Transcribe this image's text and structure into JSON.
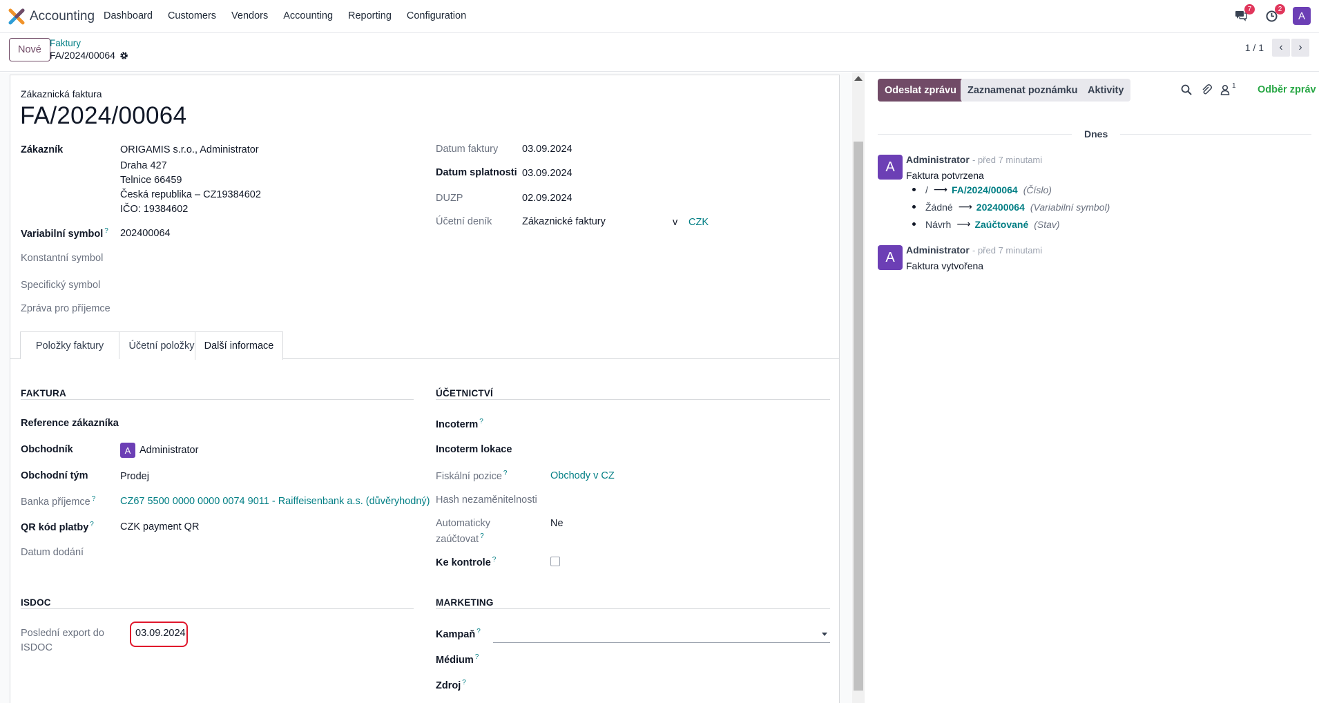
{
  "navbar": {
    "app_name": "Accounting",
    "menu": [
      "Dashboard",
      "Customers",
      "Vendors",
      "Accounting",
      "Reporting",
      "Configuration"
    ],
    "messages_count": "7",
    "activities_count": "2",
    "user_initial": "A"
  },
  "control_panel": {
    "new_label": "Nové",
    "breadcrumb_parent": "Faktury",
    "breadcrumb_current": "FA/2024/00064",
    "pager_value": "1 / 1"
  },
  "invoice": {
    "doc_type": "Zákaznická faktura",
    "number": "FA/2024/00064",
    "customer_label": "Zákazník",
    "customer_lines": [
      "ORIGAMIS s.r.o., Administrator",
      "Draha 427",
      "Telnice 66459",
      "Česká republika – CZ19384602",
      "IČO: 19384602"
    ],
    "variable_symbol_label": "Variabilní symbol",
    "variable_symbol": "202400064",
    "constant_symbol_label": "Konstantní symbol",
    "specific_symbol_label": "Specifický symbol",
    "message_label": "Zpráva pro příjemce",
    "invoice_date_label": "Datum faktury",
    "invoice_date": "03.09.2024",
    "due_date_label": "Datum splatnosti",
    "due_date": "03.09.2024",
    "duzp_label": "DUZP",
    "duzp": "02.09.2024",
    "journal_label": "Účetní deník",
    "journal": "Zákaznické faktury",
    "journal_in": "v",
    "currency": "CZK"
  },
  "tabs": [
    "Položky faktury",
    "Účetní položky",
    "Další informace"
  ],
  "faktura_section": {
    "title": "FAKTURA",
    "customer_ref_label": "Reference zákazníka",
    "salesperson_label": "Obchodník",
    "salesperson_initial": "A",
    "salesperson": "Administrator",
    "sales_team_label": "Obchodní tým",
    "sales_team": "Prodej",
    "bank_label": "Banka příjemce",
    "bank": "CZ67 5500 0000 0000 0074 9011 - Raiffeisenbank a.s. (důvěryhodný)",
    "qr_label": "QR kód platby",
    "qr": "CZK payment QR",
    "delivery_date_label": "Datum dodání"
  },
  "isdoc_section": {
    "title": "ISDOC",
    "last_export_label_1": "Poslední export do",
    "last_export_label_2": "ISDOC",
    "last_export": "03.09.2024"
  },
  "accounting_section": {
    "title": "ÚČETNICTVÍ",
    "incoterm_label": "Incoterm",
    "incoterm_location_label": "Incoterm lokace",
    "fiscal_position_label": "Fiskální pozice",
    "fiscal_position": "Obchody v CZ",
    "hash_label": "Hash nezaměnitelnosti",
    "auto_post_label_1": "Automaticky",
    "auto_post_label_2": "zaúčtovat",
    "auto_post": "Ne",
    "to_check_label": "Ke kontrole"
  },
  "marketing_section": {
    "title": "MARKETING",
    "campaign_label": "Kampaň",
    "medium_label": "Médium",
    "source_label": "Zdroj"
  },
  "help_mark": "?",
  "chatter": {
    "send_label": "Odeslat zprávu",
    "note_label": "Zaznamenat poznámku",
    "activities_label": "Aktivity",
    "followers_count": "1",
    "follow_label": "Odběr zpráv",
    "day_label": "Dnes",
    "messages": [
      {
        "initial": "A",
        "author": "Administrator",
        "time": "- před 7 minutami",
        "body": "Faktura potvrzena",
        "tracking": [
          {
            "old": "/",
            "new": "FA/2024/00064",
            "field": "(Číslo)"
          },
          {
            "old": "Žádné",
            "new": "202400064",
            "field": "(Variabilní symbol)"
          },
          {
            "old": "Návrh",
            "new": "Zaúčtované",
            "field": "(Stav)"
          }
        ]
      },
      {
        "initial": "A",
        "author": "Administrator",
        "time": "- před 7 minutami",
        "body": "Faktura vytvořena"
      }
    ]
  }
}
